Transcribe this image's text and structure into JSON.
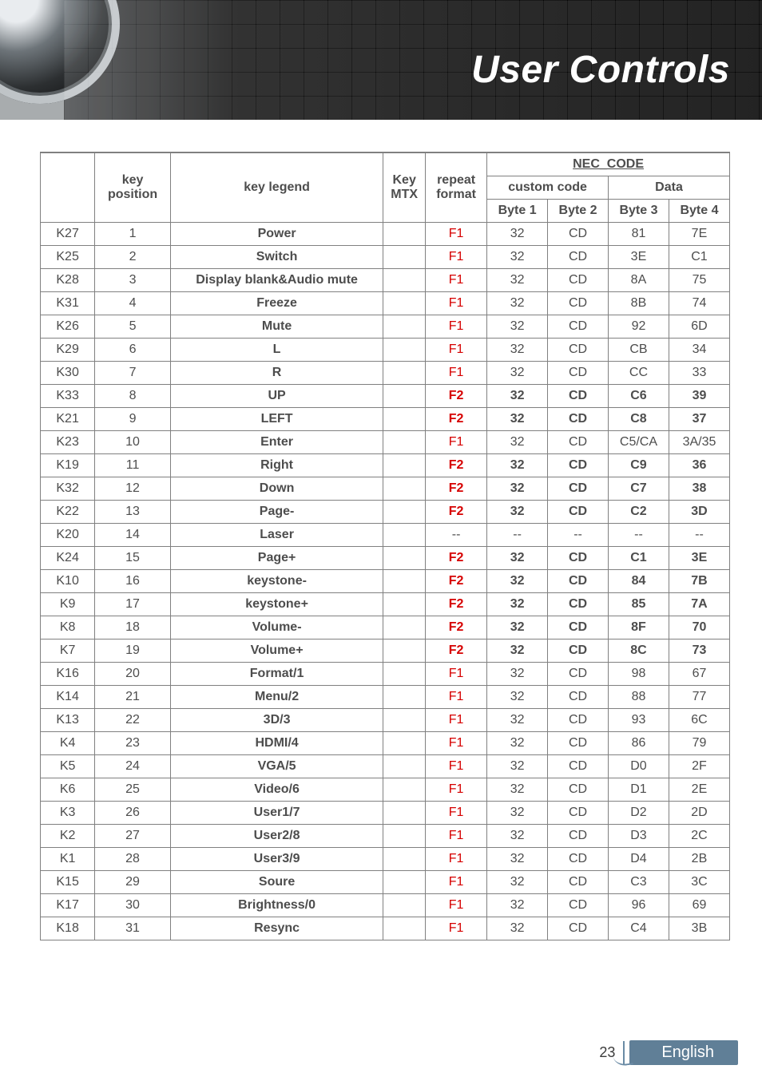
{
  "banner": {
    "title": "User Controls"
  },
  "footer": {
    "page": "23",
    "lang": "English"
  },
  "header": {
    "keyId": "",
    "keyPos": "key position",
    "keyLegend": "key legend",
    "keyMtx": "Key MTX",
    "repeat": "repeat format",
    "nec": "NEC_CODE",
    "custom": "custom code",
    "data": "Data",
    "b1": "Byte 1",
    "b2": "Byte 2",
    "b3": "Byte 3",
    "b4": "Byte 4"
  },
  "rows": [
    {
      "id": "K27",
      "pos": "1",
      "legend": "Power",
      "mtx": "",
      "rf": "F1",
      "rfStyle": "f1",
      "bold": false,
      "b1": "32",
      "b2": "CD",
      "b3": "81",
      "b4": "7E"
    },
    {
      "id": "K25",
      "pos": "2",
      "legend": "Switch",
      "mtx": "",
      "rf": "F1",
      "rfStyle": "f1",
      "bold": false,
      "b1": "32",
      "b2": "CD",
      "b3": "3E",
      "b4": "C1"
    },
    {
      "id": "K28",
      "pos": "3",
      "legend": "Display blank&Audio mute",
      "mtx": "",
      "rf": "F1",
      "rfStyle": "f1",
      "bold": false,
      "b1": "32",
      "b2": "CD",
      "b3": "8A",
      "b4": "75"
    },
    {
      "id": "K31",
      "pos": "4",
      "legend": "Freeze",
      "mtx": "",
      "rf": "F1",
      "rfStyle": "f1",
      "bold": false,
      "b1": "32",
      "b2": "CD",
      "b3": "8B",
      "b4": "74"
    },
    {
      "id": "K26",
      "pos": "5",
      "legend": "Mute",
      "mtx": "",
      "rf": "F1",
      "rfStyle": "f1",
      "bold": false,
      "b1": "32",
      "b2": "CD",
      "b3": "92",
      "b4": "6D"
    },
    {
      "id": "K29",
      "pos": "6",
      "legend": "L",
      "mtx": "",
      "rf": "F1",
      "rfStyle": "f1",
      "bold": false,
      "b1": "32",
      "b2": "CD",
      "b3": "CB",
      "b4": "34"
    },
    {
      "id": "K30",
      "pos": "7",
      "legend": "R",
      "mtx": "",
      "rf": "F1",
      "rfStyle": "f1",
      "bold": false,
      "b1": "32",
      "b2": "CD",
      "b3": "CC",
      "b4": "33"
    },
    {
      "id": "K33",
      "pos": "8",
      "legend": "UP",
      "mtx": "",
      "rf": "F2",
      "rfStyle": "f2",
      "bold": true,
      "b1": "32",
      "b2": "CD",
      "b3": "C6",
      "b4": "39"
    },
    {
      "id": "K21",
      "pos": "9",
      "legend": "LEFT",
      "mtx": "",
      "rf": "F2",
      "rfStyle": "f2",
      "bold": true,
      "b1": "32",
      "b2": "CD",
      "b3": "C8",
      "b4": "37"
    },
    {
      "id": "K23",
      "pos": "10",
      "legend": "Enter",
      "mtx": "",
      "rf": "F1",
      "rfStyle": "f1",
      "bold": false,
      "b1": "32",
      "b2": "CD",
      "b3": "C5/CA",
      "b4": "3A/35"
    },
    {
      "id": "K19",
      "pos": "11",
      "legend": "Right",
      "mtx": "",
      "rf": "F2",
      "rfStyle": "f2",
      "bold": true,
      "b1": "32",
      "b2": "CD",
      "b3": "C9",
      "b4": "36"
    },
    {
      "id": "K32",
      "pos": "12",
      "legend": "Down",
      "mtx": "",
      "rf": "F2",
      "rfStyle": "f2",
      "bold": true,
      "b1": "32",
      "b2": "CD",
      "b3": "C7",
      "b4": "38"
    },
    {
      "id": "K22",
      "pos": "13",
      "legend": "Page-",
      "mtx": "",
      "rf": "F2",
      "rfStyle": "f2",
      "bold": true,
      "b1": "32",
      "b2": "CD",
      "b3": "C2",
      "b4": "3D"
    },
    {
      "id": "K20",
      "pos": "14",
      "legend": "Laser",
      "mtx": "",
      "rf": "--",
      "rfStyle": "dash",
      "bold": false,
      "b1": "--",
      "b2": "--",
      "b3": "--",
      "b4": "--"
    },
    {
      "id": "K24",
      "pos": "15",
      "legend": "Page+",
      "mtx": "",
      "rf": "F2",
      "rfStyle": "f2",
      "bold": true,
      "b1": "32",
      "b2": "CD",
      "b3": "C1",
      "b4": "3E"
    },
    {
      "id": "K10",
      "pos": "16",
      "legend": "keystone-",
      "mtx": "",
      "rf": "F2",
      "rfStyle": "f2",
      "bold": true,
      "b1": "32",
      "b2": "CD",
      "b3": "84",
      "b4": "7B"
    },
    {
      "id": "K9",
      "pos": "17",
      "legend": "keystone+",
      "mtx": "",
      "rf": "F2",
      "rfStyle": "f2",
      "bold": true,
      "b1": "32",
      "b2": "CD",
      "b3": "85",
      "b4": "7A"
    },
    {
      "id": "K8",
      "pos": "18",
      "legend": "Volume-",
      "mtx": "",
      "rf": "F2",
      "rfStyle": "f2",
      "bold": true,
      "b1": "32",
      "b2": "CD",
      "b3": "8F",
      "b4": "70"
    },
    {
      "id": "K7",
      "pos": "19",
      "legend": "Volume+",
      "mtx": "",
      "rf": "F2",
      "rfStyle": "f2",
      "bold": true,
      "b1": "32",
      "b2": "CD",
      "b3": "8C",
      "b4": "73"
    },
    {
      "id": "K16",
      "pos": "20",
      "legend": "Format/1",
      "mtx": "",
      "rf": "F1",
      "rfStyle": "f1",
      "bold": false,
      "b1": "32",
      "b2": "CD",
      "b3": "98",
      "b4": "67"
    },
    {
      "id": "K14",
      "pos": "21",
      "legend": "Menu/2",
      "mtx": "",
      "rf": "F1",
      "rfStyle": "f1",
      "bold": false,
      "b1": "32",
      "b2": "CD",
      "b3": "88",
      "b4": "77"
    },
    {
      "id": "K13",
      "pos": "22",
      "legend": "3D/3",
      "mtx": "",
      "rf": "F1",
      "rfStyle": "f1",
      "bold": false,
      "b1": "32",
      "b2": "CD",
      "b3": "93",
      "b4": "6C"
    },
    {
      "id": "K4",
      "pos": "23",
      "legend": "HDMI/4",
      "mtx": "",
      "rf": "F1",
      "rfStyle": "f1",
      "bold": false,
      "b1": "32",
      "b2": "CD",
      "b3": "86",
      "b4": "79"
    },
    {
      "id": "K5",
      "pos": "24",
      "legend": "VGA/5",
      "mtx": "",
      "rf": "F1",
      "rfStyle": "f1",
      "bold": false,
      "b1": "32",
      "b2": "CD",
      "b3": "D0",
      "b4": "2F"
    },
    {
      "id": "K6",
      "pos": "25",
      "legend": "Video/6",
      "mtx": "",
      "rf": "F1",
      "rfStyle": "f1",
      "bold": false,
      "b1": "32",
      "b2": "CD",
      "b3": "D1",
      "b4": "2E"
    },
    {
      "id": "K3",
      "pos": "26",
      "legend": "User1/7",
      "mtx": "",
      "rf": "F1",
      "rfStyle": "f1",
      "bold": false,
      "b1": "32",
      "b2": "CD",
      "b3": "D2",
      "b4": "2D"
    },
    {
      "id": "K2",
      "pos": "27",
      "legend": "User2/8",
      "mtx": "",
      "rf": "F1",
      "rfStyle": "f1",
      "bold": false,
      "b1": "32",
      "b2": "CD",
      "b3": "D3",
      "b4": "2C"
    },
    {
      "id": "K1",
      "pos": "28",
      "legend": "User3/9",
      "mtx": "",
      "rf": "F1",
      "rfStyle": "f1",
      "bold": false,
      "b1": "32",
      "b2": "CD",
      "b3": "D4",
      "b4": "2B"
    },
    {
      "id": "K15",
      "pos": "29",
      "legend": "Soure",
      "mtx": "",
      "rf": "F1",
      "rfStyle": "f1",
      "bold": false,
      "b1": "32",
      "b2": "CD",
      "b3": "C3",
      "b4": "3C"
    },
    {
      "id": "K17",
      "pos": "30",
      "legend": "Brightness/0",
      "mtx": "",
      "rf": "F1",
      "rfStyle": "f1",
      "bold": false,
      "b1": "32",
      "b2": "CD",
      "b3": "96",
      "b4": "69"
    },
    {
      "id": "K18",
      "pos": "31",
      "legend": "Resync",
      "mtx": "",
      "rf": "F1",
      "rfStyle": "f1",
      "bold": false,
      "b1": "32",
      "b2": "CD",
      "b3": "C4",
      "b4": "3B"
    }
  ]
}
